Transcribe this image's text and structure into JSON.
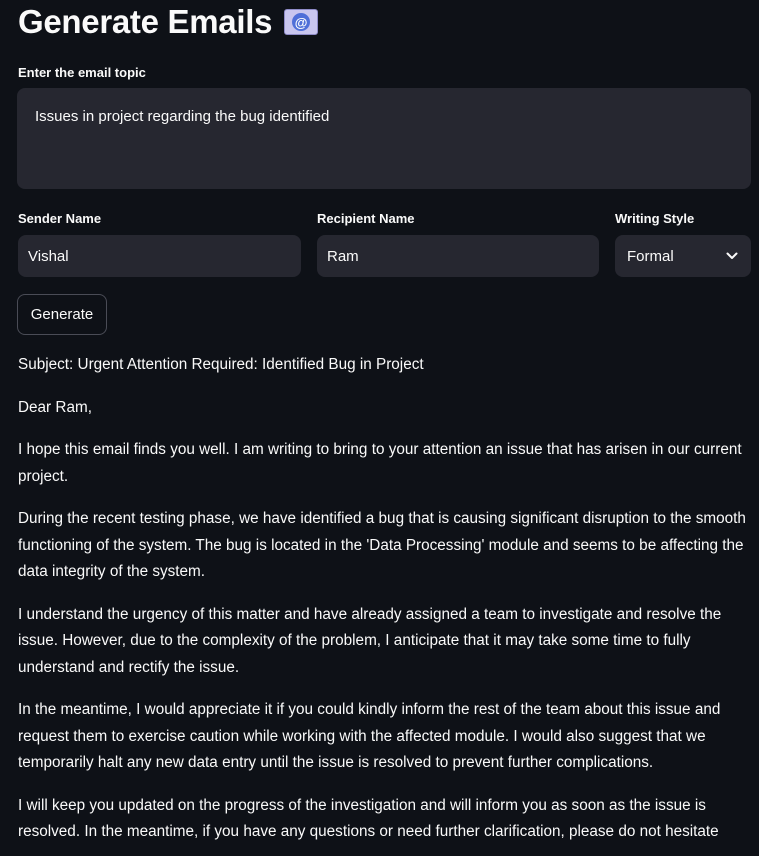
{
  "header": {
    "title": "Generate Emails",
    "emoji_icon": "e-mail-at-icon"
  },
  "form": {
    "topic_label": "Enter the email topic",
    "topic_value": "Issues in project regarding the bug identified",
    "sender_label": "Sender Name",
    "sender_value": "Vishal",
    "recipient_label": "Recipient Name",
    "recipient_value": "Ram",
    "style_label": "Writing Style",
    "style_value": "Formal",
    "generate_label": "Generate"
  },
  "email": {
    "subject": "Subject: Urgent Attention Required: Identified Bug in Project",
    "greeting": "Dear Ram,",
    "paragraphs": [
      "I hope this email finds you well. I am writing to bring to your attention an issue that has arisen in our current project.",
      "During the recent testing phase, we have identified a bug that is causing significant disruption to the smooth functioning of the system. The bug is located in the 'Data Processing' module and seems to be affecting the data integrity of the system.",
      "I understand the urgency of this matter and have already assigned a team to investigate and resolve the issue. However, due to the complexity of the problem, I anticipate that it may take some time to fully understand and rectify the issue.",
      "In the meantime, I would appreciate it if you could kindly inform the rest of the team about this issue and request them to exercise caution while working with the affected module. I would also suggest that we temporarily halt any new data entry until the issue is resolved to prevent further complications.",
      "I will keep you updated on the progress of the investigation and will inform you as soon as the issue is resolved. In the meantime, if you have any questions or need further clarification, please do not hesitate"
    ]
  }
}
